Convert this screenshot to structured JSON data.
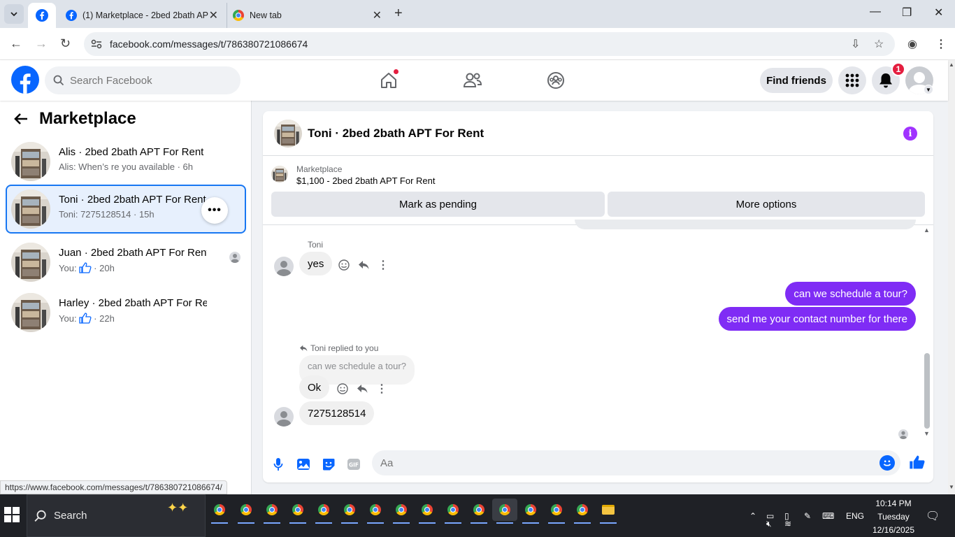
{
  "browser": {
    "tabs": [
      {
        "title": "(1) Marketplace - 2bed 2bath APT For Rent",
        "active": true
      },
      {
        "title": "New tab",
        "active": false
      }
    ],
    "url": "facebook.com/messages/t/786380721086674",
    "status_url": "https://www.facebook.com/messages/t/786380721086674/"
  },
  "header": {
    "search_placeholder": "Search Facebook",
    "find_friends": "Find friends",
    "notification_count": "1",
    "colors": {
      "brand": "#0866ff",
      "badge": "#e41e3f"
    }
  },
  "sidebar": {
    "title": "Marketplace",
    "conversations": [
      {
        "name": "Alis · 2bed 2bath APT For Rent",
        "preview": "Alis: When’s re you available",
        "time": "6h",
        "active": false
      },
      {
        "name": "Toni · 2bed 2bath APT For Rent",
        "preview": "Toni: 7275128514",
        "time": "15h",
        "active": true
      },
      {
        "name": "Juan · 2bed 2bath APT For Rent",
        "preview": "You:",
        "time": "20h",
        "active": false
      },
      {
        "name": "Harley · 2bed 2bath APT For Rent",
        "preview": "You:",
        "time": "22h",
        "active": false
      }
    ]
  },
  "chat": {
    "title": "Toni · 2bed 2bath APT For Rent",
    "listing_source": "Marketplace",
    "listing_price": "$1,100 - 2bed 2bath APT For Rent",
    "mark_pending": "Mark as pending",
    "more_options": "More options",
    "messages": {
      "sender": "Toni",
      "in_1": "yes",
      "out_1": "can we schedule a tour?",
      "out_2": "send me your contact number for there",
      "reply_note": "Toni replied to you",
      "quoted": "can we schedule a tour?",
      "in_2": "Ok",
      "in_3": "7275128514"
    },
    "composer_placeholder": "Aa",
    "colors": {
      "outgoing": "#7f2cf5",
      "info": "#a033ff"
    }
  },
  "taskbar": {
    "search_label": "Search",
    "lang": "ENG",
    "time": "10:14 PM",
    "day": "Tuesday",
    "date": "12/16/2025"
  }
}
